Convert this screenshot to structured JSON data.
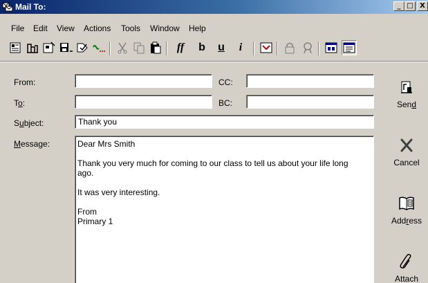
{
  "window": {
    "title": "Mail To:",
    "controls": [
      "_",
      "□",
      "X"
    ]
  },
  "menu": {
    "items": [
      "File",
      "Edit",
      "View",
      "Actions",
      "Tools",
      "Window",
      "Help"
    ]
  },
  "toolbar": {
    "icons": [
      "new-message-icon",
      "chart-icon",
      "open-icon",
      "save-icon",
      "spell-check-icon",
      "signature-icon",
      "cut-icon",
      "copy-icon",
      "paste-icon",
      "font-icon",
      "bold-icon",
      "underline-icon",
      "italic-icon",
      "address-book-icon",
      "lock-icon",
      "certificate-icon",
      "window-icon",
      "window-active-icon"
    ],
    "font_label": "ff",
    "bold_label": "b",
    "underline_label": "u",
    "italic_label": "i"
  },
  "form": {
    "from_label": "From:",
    "to_label_pre": "T",
    "to_label_u": "o",
    "to_label_post": ":",
    "cc_label": "CC:",
    "bc_label": "BC:",
    "subject_label_pre": "S",
    "subject_label_u": "u",
    "subject_label_post": "bject:",
    "message_label_pre": "",
    "message_label_u": "M",
    "message_label_post": "essage:",
    "from_value": "",
    "to_value": "",
    "cc_value": "",
    "bc_value": "",
    "subject_value": "Thank you"
  },
  "message": {
    "lines": [
      "Dear Mrs Smith",
      "",
      "Thank you very much for coming to our class to tell us about your life long",
      "ago.",
      "",
      "It was very interesting.",
      "",
      "From",
      "Primary 1"
    ]
  },
  "actions": {
    "send_pre": "Sen",
    "send_u": "d",
    "send_post": "",
    "cancel": "Cancel",
    "address_pre": "Add",
    "address_u": "r",
    "address_post": "ess",
    "attach": "Attach"
  }
}
